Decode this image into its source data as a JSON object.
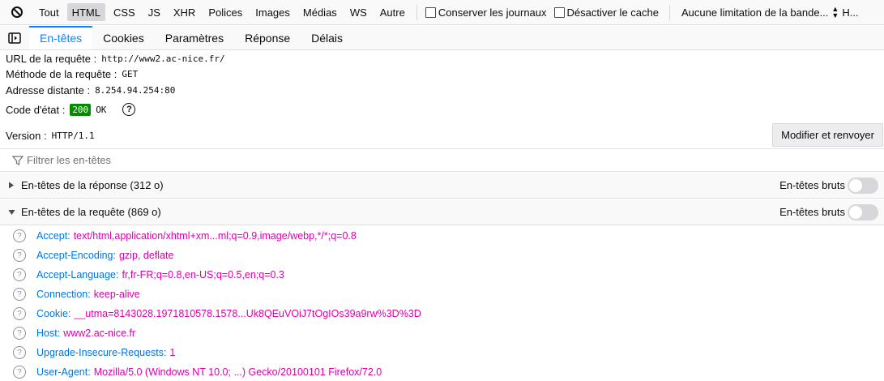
{
  "toolbar": {
    "filters": [
      "Tout",
      "HTML",
      "CSS",
      "JS",
      "XHR",
      "Polices",
      "Images",
      "Médias",
      "WS",
      "Autre"
    ],
    "active_filter": "HTML",
    "persist_logs_label": "Conserver les journaux",
    "disable_cache_label": "Désactiver le cache",
    "throttling_value": "Aucune limitation de la bande...",
    "har_label": "H..."
  },
  "tabs": [
    "En-têtes",
    "Cookies",
    "Paramètres",
    "Réponse",
    "Délais"
  ],
  "summary": {
    "url_label": "URL de la requête :",
    "url_value": "http://www2.ac-nice.fr/",
    "method_label": "Méthode de la requête :",
    "method_value": "GET",
    "remote_label": "Adresse distante :",
    "remote_value": "8.254.94.254:80",
    "status_label": "Code d'état :",
    "status_code": "200",
    "status_text": "OK",
    "version_label": "Version :",
    "version_value": "HTTP/1.1",
    "resend_label": "Modifier et renvoyer"
  },
  "filter": {
    "placeholder": "Filtrer les en-têtes"
  },
  "response_section": {
    "title": "En-têtes de la réponse (312 o)",
    "raw_label": "En-têtes bruts"
  },
  "request_section": {
    "title": "En-têtes de la requête (869 o)",
    "raw_label": "En-têtes bruts"
  },
  "request_headers": [
    {
      "name": "Accept:",
      "value": "text/html,application/xhtml+xm...ml;q=0.9,image/webp,*/*;q=0.8"
    },
    {
      "name": "Accept-Encoding:",
      "value": "gzip, deflate"
    },
    {
      "name": "Accept-Language:",
      "value": "fr,fr-FR;q=0.8,en-US;q=0.5,en;q=0.3"
    },
    {
      "name": "Connection:",
      "value": "keep-alive"
    },
    {
      "name": "Cookie:",
      "value": "__utma=8143028.1971810578.1578...Uk8QEuVOiJ7tOgIOs39a9rw%3D%3D"
    },
    {
      "name": "Host:",
      "value": "www2.ac-nice.fr"
    },
    {
      "name": "Upgrade-Insecure-Requests:",
      "value": "1"
    },
    {
      "name": "User-Agent:",
      "value": "Mozilla/5.0 (Windows NT 10.0; ...) Gecko/20100101 Firefox/72.0"
    }
  ],
  "colors": {
    "accent": "#0a84ff",
    "status_ok": "#058b00",
    "header_name": "#0074e8",
    "header_value": "#dd00a9"
  }
}
